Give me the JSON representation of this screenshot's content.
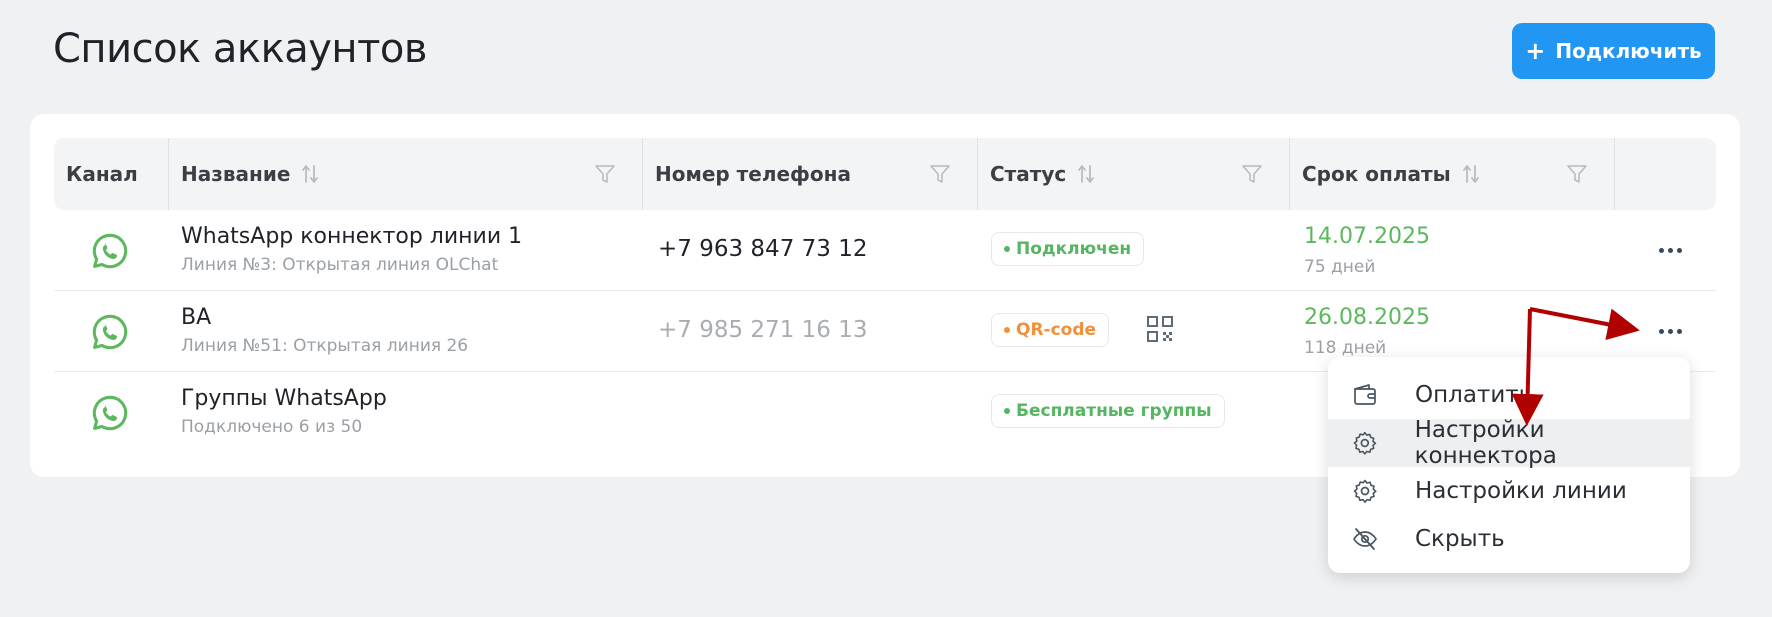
{
  "header": {
    "title": "Список аккаунтов",
    "connect_button": {
      "plus": "+",
      "label": "Подключить"
    }
  },
  "table": {
    "columns": {
      "channel": "Канал",
      "name": "Название",
      "phone": "Номер телефона",
      "status": "Статус",
      "payment": "Срок оплаты"
    },
    "rows": [
      {
        "name": "WhatsApp коннектор линии 1",
        "subtitle": "Линия №3: Открытая линия OLChat",
        "phone": "+7 963 847 73 12",
        "status": "Подключен",
        "status_color": "#55b560",
        "date": "14.07.2025",
        "days": "75 дней"
      },
      {
        "name": "ВА",
        "subtitle": "Линия №51: Открытая линия 26",
        "phone": "+7 985 271 16 13",
        "status": "QR-code",
        "status_color": "#f0903a",
        "date": "26.08.2025",
        "days": "118 дней"
      },
      {
        "name": "Группы WhatsApp",
        "subtitle": "Подключено 6 из 50",
        "phone": "",
        "status": "Бесплатные группы",
        "status_color": "#55b560",
        "date": "",
        "days": ""
      }
    ]
  },
  "context_menu": {
    "items": [
      {
        "label": "Оплатить",
        "icon": "wallet-icon"
      },
      {
        "label": "Настройки коннектора",
        "icon": "gear-icon"
      },
      {
        "label": "Настройки линии",
        "icon": "gear-icon"
      },
      {
        "label": "Скрыть",
        "icon": "eye-off-icon"
      }
    ]
  },
  "colors": {
    "primary": "#2196f3",
    "whatsapp_green": "#5cb85c",
    "date_green": "#5cb85c",
    "annotation_arrow": "#b00000"
  }
}
